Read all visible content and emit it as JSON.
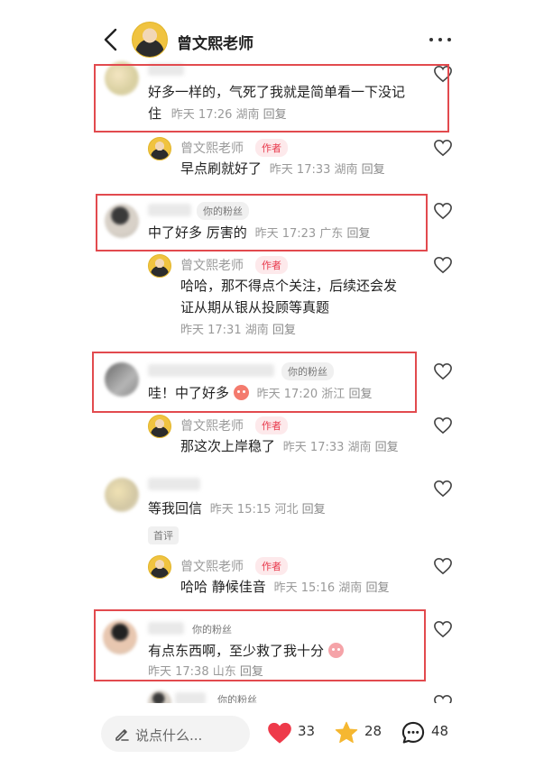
{
  "header": {
    "name": "曾文熙老师"
  },
  "comments": [
    {
      "text_line1": "好多一样的，气死了我就是简单看一下没记",
      "text_line2_prefix": "住",
      "meta": "昨天 17:26 湖南",
      "reply": "回复"
    },
    {
      "name": "曾文熙老师",
      "badge": "作者",
      "text": "早点刷就好了",
      "meta": "昨天 17:33 湖南",
      "reply": "回复"
    },
    {
      "badge": "你的粉丝",
      "text": "中了好多 厉害的",
      "meta": "昨天 17:23 广东",
      "reply": "回复"
    },
    {
      "name": "曾文熙老师",
      "badge": "作者",
      "text_line1": "哈哈，那不得点个关注，后续还会发",
      "text_line2": "证从期从银从投顾等真题",
      "meta": "昨天 17:31 湖南",
      "reply": "回复"
    },
    {
      "badge": "你的粉丝",
      "text": "哇！中了好多",
      "meta": "昨天 17:20 浙江",
      "reply": "回复"
    },
    {
      "name": "曾文熙老师",
      "badge": "作者",
      "text": "那这次上岸稳了",
      "meta": "昨天 17:33 湖南",
      "reply": "回复"
    },
    {
      "text": "等我回信",
      "meta": "昨天 15:15 河北",
      "reply": "回复",
      "tag": "首评"
    },
    {
      "name": "曾文熙老师",
      "badge": "作者",
      "text": "哈哈 静候佳音",
      "meta": "昨天 15:16 湖南",
      "reply": "回复"
    },
    {
      "badge": "你的粉丝",
      "text": "有点东西啊，至少救了我十分",
      "meta": "昨天 17:38 山东",
      "reply": "回复"
    },
    {
      "badge": "你的粉丝"
    }
  ],
  "bottom": {
    "placeholder": "说点什么...",
    "likes": "33",
    "stars": "28",
    "comments": "48"
  },
  "colors": {
    "accent": "#e8394c",
    "highlight_box": "#e24a4e",
    "star": "#f5b731"
  }
}
